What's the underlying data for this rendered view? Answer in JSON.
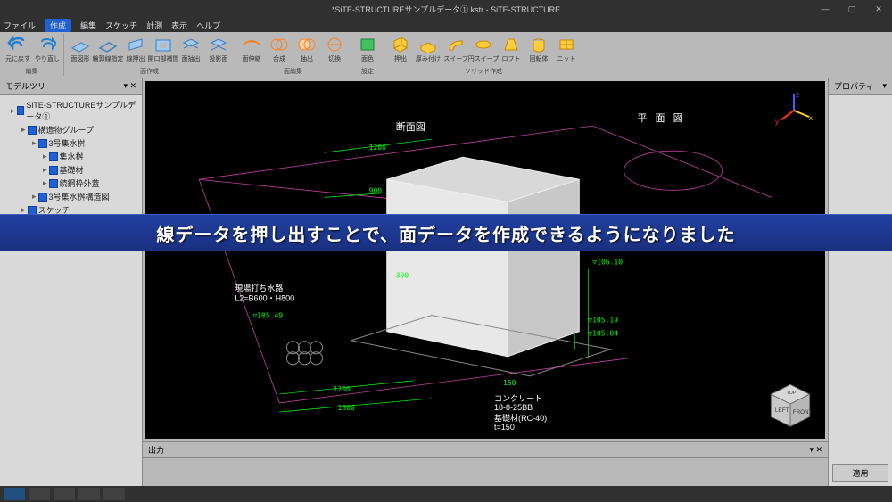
{
  "title": "*SiTE-STRUCTUREサンプルデータ①.kstr - SiTE-STRUCTURE",
  "menu": {
    "file": "ファイル",
    "create": "作成",
    "edit": "編集",
    "sketch": "スケッチ",
    "measure": "計測",
    "view": "表示",
    "help": "ヘルプ"
  },
  "ribbon": {
    "undo": "元に戻す",
    "redo": "やり直し",
    "create_group_label": "面作成",
    "surface": "面図形",
    "edge": "輪郭線指定",
    "extrude": "線押出",
    "opening": "開口部補間",
    "surfext": "面抽出",
    "project": "投影面",
    "faceedit_label": "面編集",
    "fext": "面伸縮",
    "compose": "合成",
    "ext2": "抽出",
    "cutconv": "切換",
    "setting_label": "設定",
    "facecolor": "面色",
    "solid_label": "ソリッド作成",
    "push": "押出",
    "thick": "厚み付け",
    "sweep": "スイープ",
    "csweep": "円スイープ",
    "loft": "ロフト",
    "rev": "回転体",
    "knit": "ニット",
    "edit_label": "編集"
  },
  "tree_title": "モデルツリー",
  "tree": [
    {
      "d": 1,
      "label": "SiTE-STRUCTUREサンプルデータ①"
    },
    {
      "d": 2,
      "label": "構造物グループ"
    },
    {
      "d": 3,
      "label": "3号集水桝"
    },
    {
      "d": 4,
      "label": "集水桝"
    },
    {
      "d": 4,
      "label": "基礎材"
    },
    {
      "d": 4,
      "label": "続鋼枠外蓋"
    },
    {
      "d": 3,
      "label": "3号集水桝構造図"
    },
    {
      "d": 2,
      "label": "スケッチ"
    }
  ],
  "properties_title": "プロパティ",
  "apply": "適用",
  "output_title": "出力",
  "banner": "線データを押し出すことで、面データを作成できるようになりました",
  "drawing": {
    "section_title": "断面図",
    "plan_title": "平 面 図",
    "dim_top1": "1200",
    "dim_top2": "900",
    "dim_mid": "300",
    "dim_b1": "1200",
    "dim_b2": "1300",
    "dim_b3": "150",
    "note1": "現場打ち水路",
    "note1b": "L2=B600・H800",
    "elev1": "▽105.49",
    "elev2": "▽106.10",
    "elev3": "▽105.19",
    "elev4": "▽105.04",
    "note2": "コンクリート",
    "note2b": "18-8-25BB",
    "note3": "基礎材(RC-40)",
    "note3b": "t=150"
  },
  "navcube": {
    "left": "LEFT",
    "front": "FRONT",
    "top": "TOP"
  }
}
